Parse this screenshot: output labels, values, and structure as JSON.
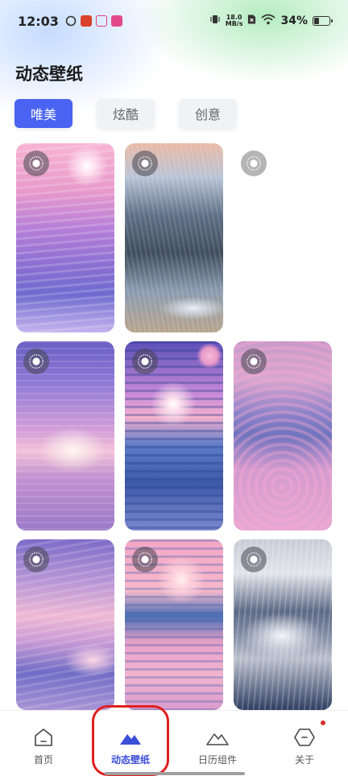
{
  "status_bar": {
    "time": "12:03",
    "net_speed_value": "18.0",
    "net_speed_unit": "MB/s",
    "battery_percent": "34%",
    "battery_level": 0.34,
    "app_icons": [
      "whatsapp-like-icon",
      "red-app-icon",
      "camera-app-icon",
      "pink-app-icon"
    ]
  },
  "header": {
    "title": "动态壁纸"
  },
  "tabs": [
    {
      "label": "唯美",
      "active": true
    },
    {
      "label": "炫酷",
      "active": false
    },
    {
      "label": "创意",
      "active": false
    }
  ],
  "wallpapers": [
    {
      "theme": "pink-sea-sunset"
    },
    {
      "theme": "snowy-mountain-valley"
    },
    {
      "theme": "loading-placeholder"
    },
    {
      "theme": "purple-sea-sunrise"
    },
    {
      "theme": "sunset-waves"
    },
    {
      "theme": "pink-flower-sea"
    },
    {
      "theme": "pink-cloud-beach"
    },
    {
      "theme": "pink-ocean-sun"
    },
    {
      "theme": "snowy-forest-mountain"
    }
  ],
  "bottom_nav": [
    {
      "label": "首页",
      "icon": "home-icon",
      "active": false
    },
    {
      "label": "动态壁纸",
      "icon": "mountain-filled-icon",
      "active": true
    },
    {
      "label": "日历组件",
      "icon": "mountain-outline-icon",
      "active": false
    },
    {
      "label": "关于",
      "icon": "hexagon-icon",
      "active": false,
      "dot": true
    }
  ],
  "colors": {
    "accent": "#4a63f2",
    "nav_active": "#3c4fd8",
    "notification_dot": "#d32f2f",
    "annotation": "#e02020"
  }
}
